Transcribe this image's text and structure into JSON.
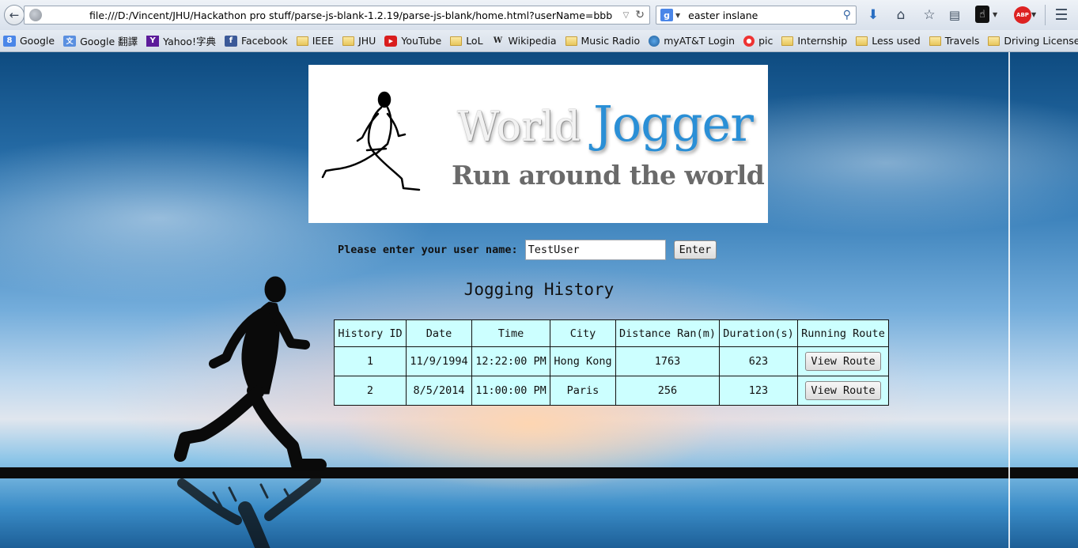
{
  "browser": {
    "url": "file:///D:/Vincent/JHU/Hackathon pro stuff/parse-js-blank-1.2.19/parse-js-blank/home.html?userName=bbb",
    "search_query": "easter inslane",
    "search_engine_icon": "google-icon",
    "bookmarks": [
      {
        "label": "Google",
        "icon": "google-icon"
      },
      {
        "label": "Google 翻譯",
        "icon": "translate-icon"
      },
      {
        "label": "Yahoo!字典",
        "icon": "yahoo-icon"
      },
      {
        "label": "Facebook",
        "icon": "facebook-icon"
      },
      {
        "label": "IEEE",
        "icon": "folder-icon"
      },
      {
        "label": "JHU",
        "icon": "folder-icon"
      },
      {
        "label": "YouTube",
        "icon": "youtube-icon"
      },
      {
        "label": "LoL",
        "icon": "folder-icon"
      },
      {
        "label": "Wikipedia",
        "icon": "wikipedia-icon"
      },
      {
        "label": "Music Radio",
        "icon": "folder-icon"
      },
      {
        "label": "myAT&T Login",
        "icon": "att-icon"
      },
      {
        "label": "pic",
        "icon": "pic-icon"
      },
      {
        "label": "Internship",
        "icon": "folder-icon"
      },
      {
        "label": "Less used",
        "icon": "folder-icon"
      },
      {
        "label": "Travels",
        "icon": "folder-icon"
      },
      {
        "label": "Driving License",
        "icon": "folder-icon"
      }
    ],
    "toolbar_icons": [
      "download-icon",
      "home-icon",
      "bookmark-star-icon",
      "reader-icon",
      "hand-cursor-icon",
      "adblock-icon",
      "menu-icon"
    ],
    "adblock_badge": "ABP"
  },
  "banner": {
    "title_word1": "World",
    "title_word2": "Jogger",
    "tagline": "Run around the world",
    "colors": {
      "jogger_blue": "#2a8fd6",
      "tagline_gray": "#6a6a6a"
    }
  },
  "form": {
    "label": "Please enter your user name:",
    "username_value": "TestUser",
    "enter_label": "Enter"
  },
  "history": {
    "title": "Jogging History",
    "columns": [
      "History ID",
      "Date",
      "Time",
      "City",
      "Distance Ran(m)",
      "Duration(s)",
      "Running Route"
    ],
    "rows": [
      {
        "id": "1",
        "date": "11/9/1994",
        "time": "12:22:00 PM",
        "city": "Hong Kong",
        "distance": "1763",
        "duration": "623",
        "route_label": "View Route"
      },
      {
        "id": "2",
        "date": "8/5/2014",
        "time": "11:00:00 PM",
        "city": "Paris",
        "distance": "256",
        "duration": "123",
        "route_label": "View Route"
      }
    ],
    "table_bg": "#ccffff"
  }
}
